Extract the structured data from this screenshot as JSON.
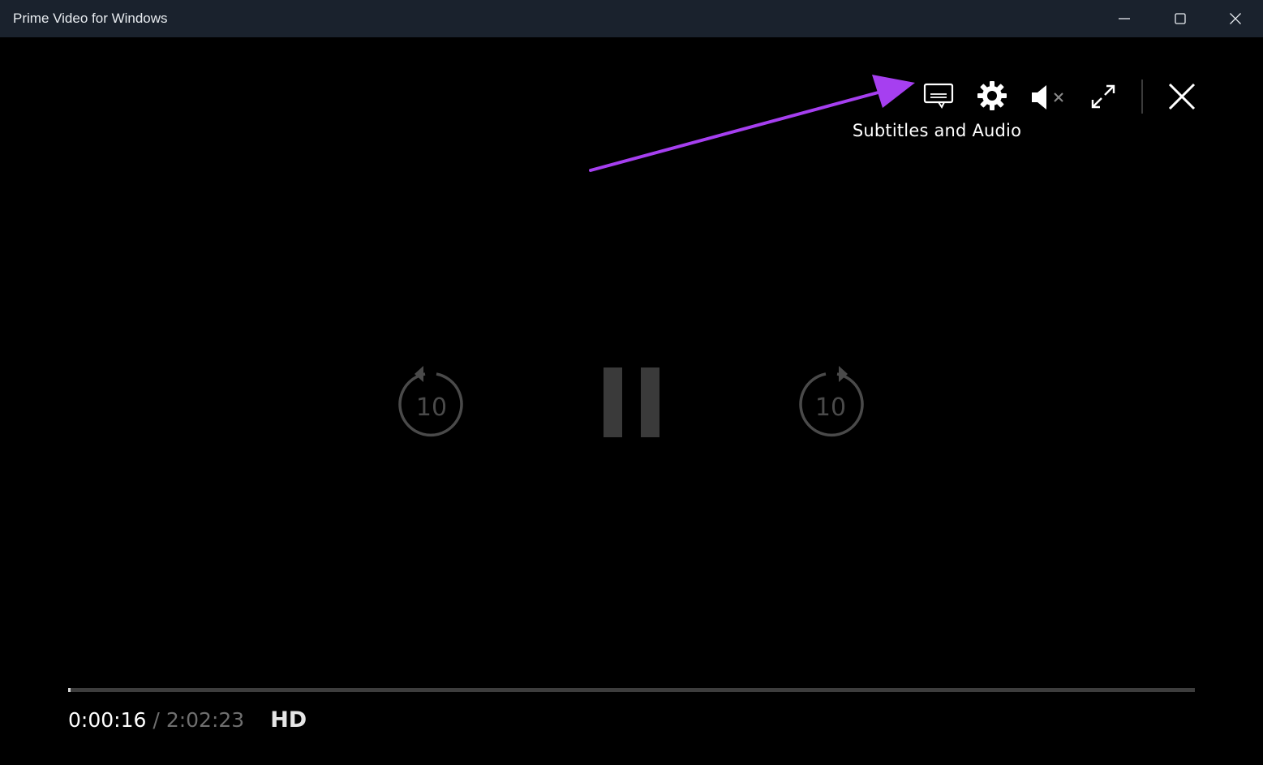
{
  "window": {
    "title": "Prime Video for Windows",
    "controls": [
      "minimize-icon",
      "maximize-icon",
      "close-icon"
    ]
  },
  "player": {
    "top_controls": [
      {
        "name": "subtitles-button",
        "icon": "subtitles-icon"
      },
      {
        "name": "settings-button",
        "icon": "gear-icon"
      },
      {
        "name": "mute-button",
        "icon": "volume-muted-icon"
      },
      {
        "name": "fullscreen-button",
        "icon": "expand-icon"
      },
      {
        "name": "exit-player-button",
        "icon": "close-icon"
      }
    ],
    "tooltip": "Subtitles and Audio",
    "center_controls": {
      "rewind_label": "10",
      "forward_label": "10",
      "pause_icon": "pause-icon"
    },
    "progress": {
      "current": "0:00:16",
      "separator": "/",
      "total": "2:02:23",
      "fraction": 0.0022
    },
    "quality": "HD"
  },
  "annotation": {
    "arrow_color": "#a63ff0"
  },
  "colors": {
    "titlebar": "#1a222d",
    "background": "#000000",
    "dim_control": "#4a4a4a",
    "progress_track": "#3d3d3d"
  }
}
